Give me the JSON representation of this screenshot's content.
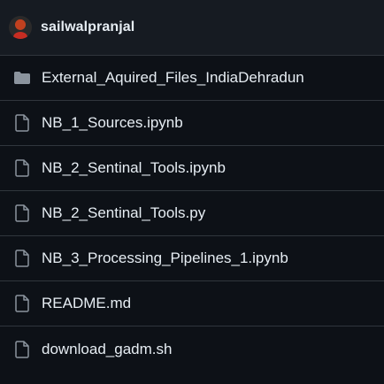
{
  "repo": {
    "owner": "sailwalpranjal"
  },
  "files": [
    {
      "name": "External_Aquired_Files_IndiaDehradun",
      "type": "folder",
      "icon": "folder-icon"
    },
    {
      "name": "NB_1_Sources.ipynb",
      "type": "file",
      "icon": "file-icon"
    },
    {
      "name": "NB_2_Sentinal_Tools.ipynb",
      "type": "file",
      "icon": "file-icon"
    },
    {
      "name": "NB_2_Sentinal_Tools.py",
      "type": "file",
      "icon": "file-icon"
    },
    {
      "name": "NB_3_Processing_Pipelines_1.ipynb",
      "type": "file",
      "icon": "file-icon"
    },
    {
      "name": "README.md",
      "type": "file",
      "icon": "file-icon"
    },
    {
      "name": "download_gadm.sh",
      "type": "file",
      "icon": "file-icon"
    }
  ],
  "colors": {
    "background": "#0d1117",
    "header_background": "#161b22",
    "border": "#30363d",
    "text": "#e6edf3",
    "icon": "#8b949e"
  }
}
